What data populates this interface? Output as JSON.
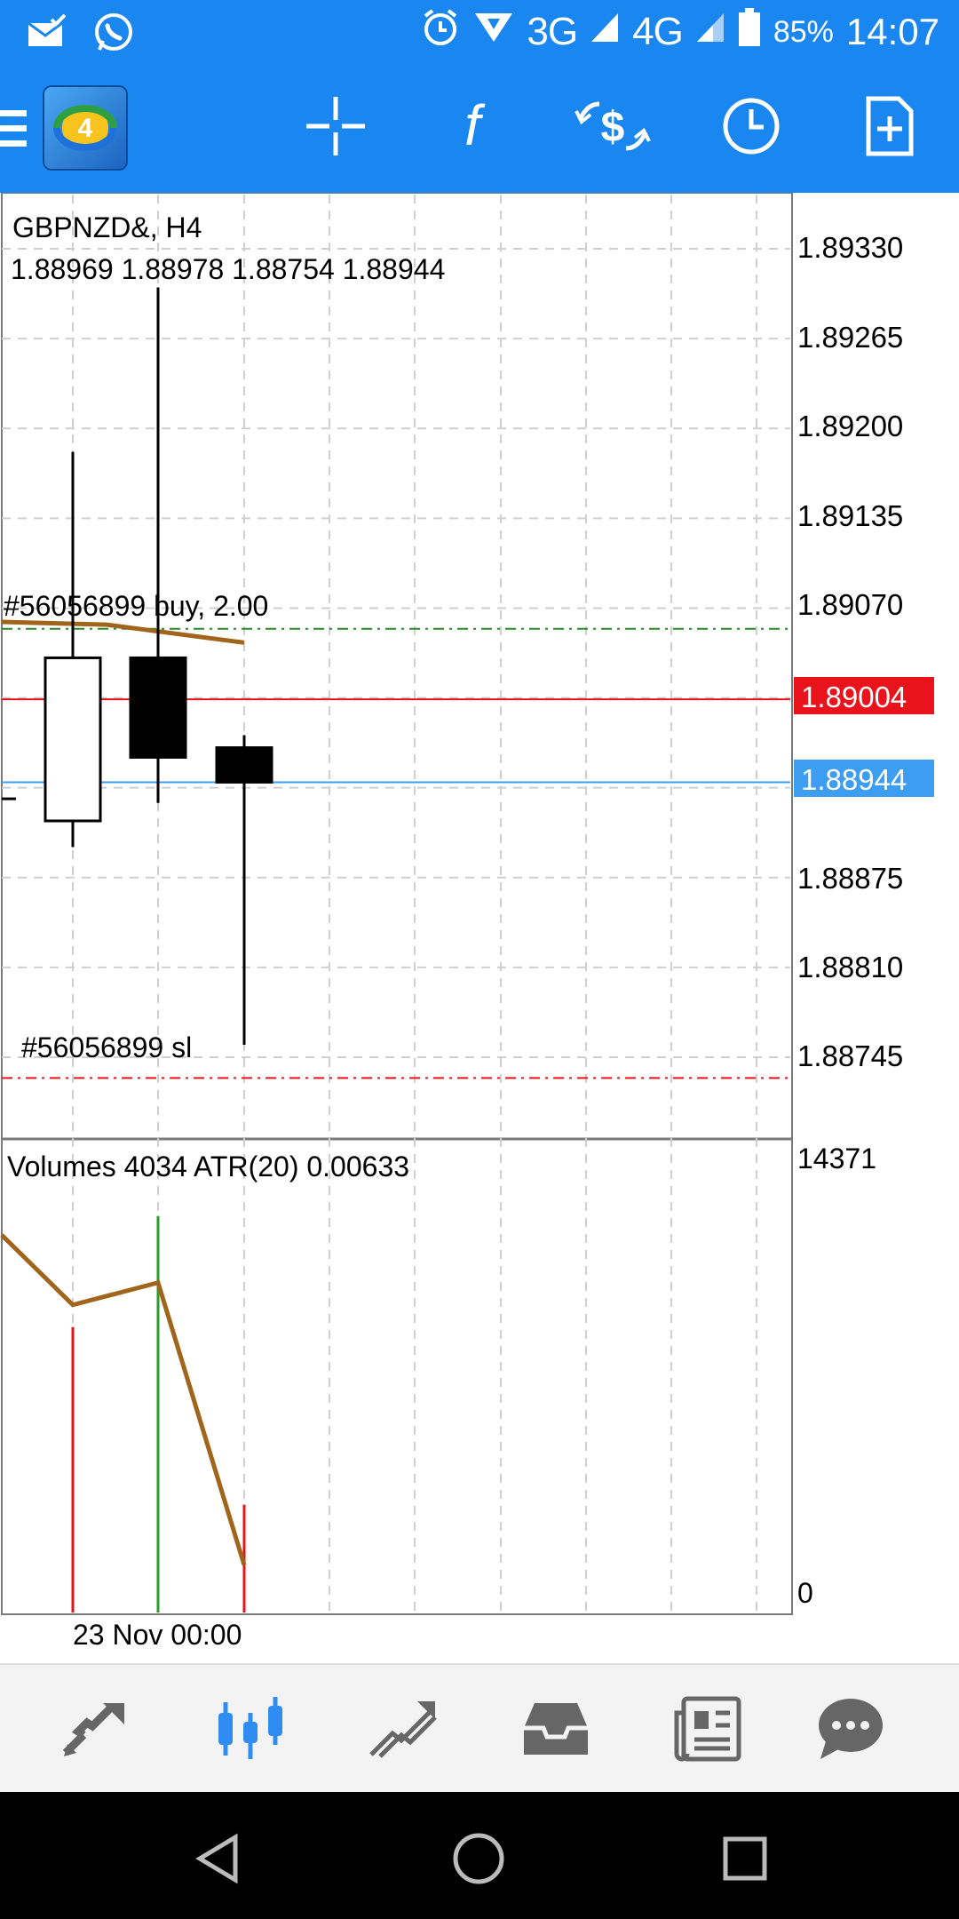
{
  "status_bar": {
    "network_3g": "3G",
    "network_4g": "4G",
    "battery": "85%",
    "time": "14:07"
  },
  "toolbar": {
    "icons": [
      "menu-icon",
      "app-logo",
      "crosshair-icon",
      "indicators-icon",
      "trade-icon",
      "timeframe-icon",
      "new-order-icon"
    ],
    "accent": "#1a86f0",
    "logo_digit": "4"
  },
  "chart": {
    "symbol_title": "GBPNZD&, H4",
    "ohlc_text": "1.88969 1.88978 1.88754 1.88944",
    "order_label": "#56056899 buy, 2.00",
    "sl_label": "#56056899 sl",
    "price_axis_labels": [
      "1.89330",
      "1.89265",
      "1.89200",
      "1.89135",
      "1.89070",
      "1.88875",
      "1.88810",
      "1.88745"
    ],
    "ask_price_tag": "1.89004",
    "bid_price_tag": "1.88944",
    "ask_color": "#e8131b",
    "bid_color": "#3d9df0",
    "volumes_label": "Volumes 4034 ATR(20) 0.00633",
    "volume_axis_max": "14371",
    "volume_axis_min": "0",
    "time_label": "23 Nov 00:00"
  },
  "chart_data": {
    "type": "candlestick",
    "title": "GBPNZD&, H4",
    "candles": [
      {
        "open": 1.88916,
        "high": 1.89183,
        "low": 1.88897,
        "close": 1.89034,
        "color": "white"
      },
      {
        "open": 1.89034,
        "high": 1.89302,
        "low": 1.88929,
        "close": 1.88962,
        "color": "black"
      },
      {
        "open": 1.88969,
        "high": 1.88978,
        "low": 1.88754,
        "close": 1.88944,
        "color": "black"
      }
    ],
    "ylim": [
      1.887,
      1.89355
    ],
    "ask": 1.89004,
    "bid": 1.88944,
    "buy_order_level": 1.89055,
    "stop_loss_level": 1.8873,
    "volumes": {
      "values": [
        9000,
        12500,
        3400
      ],
      "colors": [
        "#e8131b",
        "#2a9d2a",
        "#e8131b"
      ],
      "ylim": [
        0,
        14371
      ]
    },
    "atr": {
      "values": [
        11900,
        9700,
        10400,
        1500
      ]
    }
  },
  "bottom_nav": {
    "items": [
      "quotes-icon",
      "chart-icon",
      "trade-icon",
      "history-icon",
      "news-icon",
      "chat-icon"
    ],
    "active": "chart-icon"
  }
}
